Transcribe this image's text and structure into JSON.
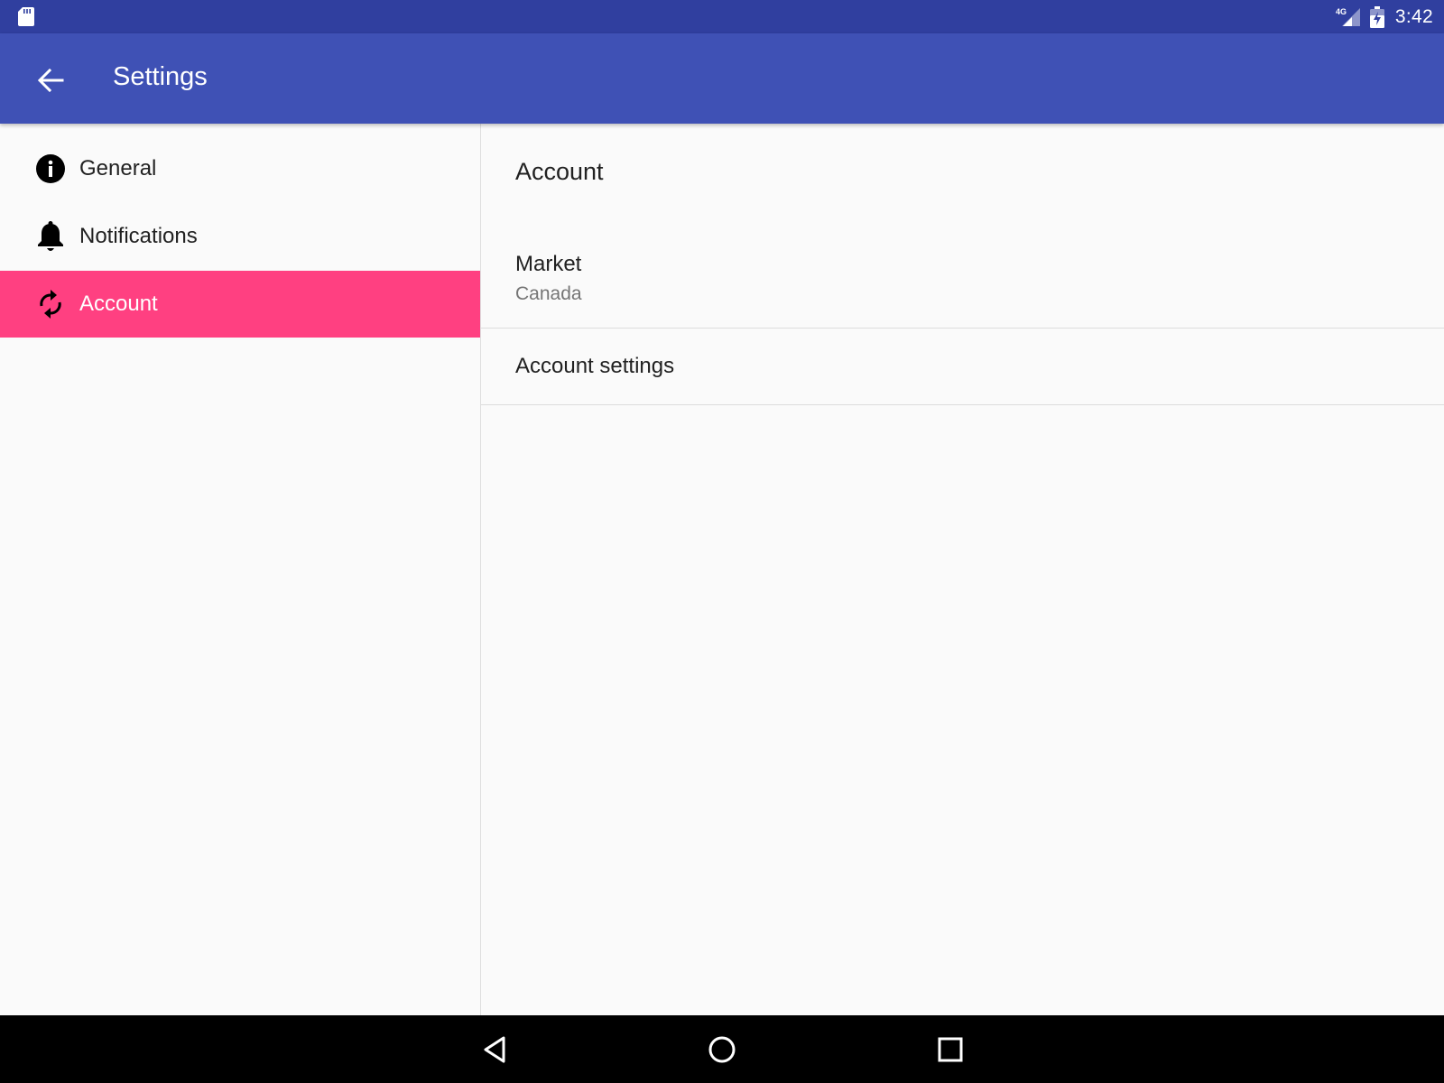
{
  "status_bar": {
    "time": "3:42",
    "network": "4G",
    "left_icon": "sd-card-icon",
    "background_color": "#303f9f"
  },
  "app_bar": {
    "title": "Settings",
    "back_icon": "arrow-back-icon",
    "background_color": "#3f51b5"
  },
  "sidebar": {
    "items": [
      {
        "label": "General",
        "icon": "info-icon",
        "active": false
      },
      {
        "label": "Notifications",
        "icon": "bell-icon",
        "active": false
      },
      {
        "label": "Account",
        "icon": "sync-icon",
        "active": true
      }
    ],
    "active_color": "#ff4081"
  },
  "content": {
    "title": "Account",
    "preferences": [
      {
        "title": "Market",
        "summary": "Canada"
      },
      {
        "title": "Account settings"
      }
    ]
  },
  "nav_bar": {
    "buttons": [
      "back-triangle-icon",
      "home-circle-icon",
      "recents-square-icon"
    ]
  }
}
